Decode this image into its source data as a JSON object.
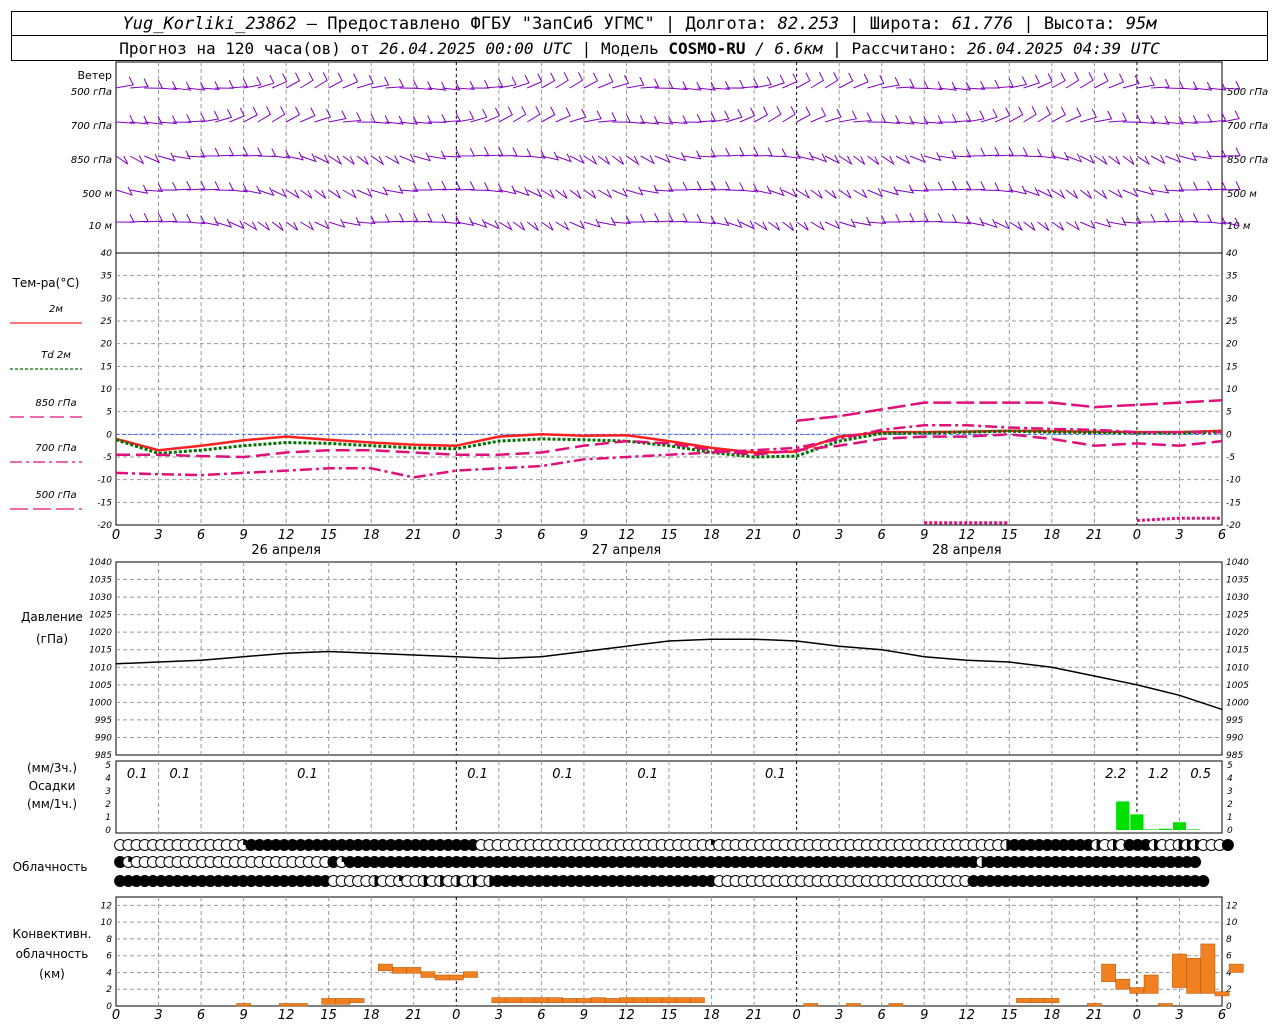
{
  "header": {
    "station": "Yug_Korliki_23862",
    "provider": "– Предоставлено ФГБУ \"ЗапСиб УГМС\"",
    "lon_label": "Долгота:",
    "lon": "82.253",
    "lat_label": "Широта:",
    "lat": "61.776",
    "alt_label": "Высота:",
    "alt": "95м",
    "forecast_prefix": "Прогноз на 120 часа(ов) от",
    "forecast_start": "26.04.2025 00:00 UTC",
    "model_label": "Модель",
    "model": "COSMO-RU",
    "model_res": "/ 6.6км",
    "calc_label": "Рассчитано:",
    "calc_time": "26.04.2025 04:39 UTC"
  },
  "colors": {
    "wind": "#8000c0",
    "t2m": "#ff2020",
    "td2m": "#007000",
    "level_lines": "#e0107a",
    "pressure": "#000000",
    "precip": "#00e000",
    "convective": "#f08020",
    "grid": "#999999"
  },
  "chart_data": [
    {
      "type": "wind_barbs",
      "title": "Ветер",
      "levels": [
        "500 гПа",
        "700 гПа",
        "850 гПа",
        "500 м",
        "10 м"
      ],
      "x_hours_step": 1,
      "x_range": [
        0,
        78
      ]
    },
    {
      "type": "line",
      "ylabel": "Тем-ра(°C)",
      "ylim": [
        -20,
        40
      ],
      "yticks": [
        40,
        35,
        30,
        25,
        20,
        15,
        10,
        5,
        0,
        -5,
        -10,
        -15,
        -20
      ],
      "x_hours": [
        0,
        3,
        6,
        9,
        12,
        15,
        18,
        21,
        24,
        27,
        30,
        33,
        36,
        39,
        42,
        45,
        48,
        51,
        54,
        57,
        60,
        63,
        66,
        69,
        72,
        75,
        78
      ],
      "x_ticklabels": [
        "0",
        "3",
        "6",
        "9",
        "12",
        "15",
        "18",
        "21",
        "0",
        "3",
        "6",
        "9",
        "12",
        "15",
        "18",
        "21",
        "0",
        "3",
        "6",
        "9",
        "12",
        "15",
        "18",
        "21",
        "0",
        "3",
        "6"
      ],
      "date_labels": [
        {
          "hour": 12,
          "label": "26 апреля"
        },
        {
          "hour": 36,
          "label": "27 апреля"
        },
        {
          "hour": 60,
          "label": "28 апреля"
        }
      ],
      "series": [
        {
          "name": "2м",
          "values": [
            -1,
            -3.5,
            -2.5,
            -1.3,
            -0.5,
            -1.2,
            -1.8,
            -2.3,
            -2.5,
            -0.5,
            0,
            -0.3,
            -0.2,
            -1.5,
            -3,
            -4,
            -3.8,
            -0.5,
            0.5,
            0.5,
            0.6,
            0.8,
            0.7,
            0.6,
            0.5,
            0.5,
            0.8
          ]
        },
        {
          "name": "Td 2м",
          "values": [
            -1.2,
            -4.2,
            -3.5,
            -2.5,
            -1.8,
            -2,
            -2.5,
            -3,
            -3.2,
            -1.5,
            -1,
            -1.2,
            -1.5,
            -2.5,
            -4,
            -5,
            -4.8,
            -1.5,
            0.2,
            0.3,
            0.5,
            0.7,
            0.5,
            0.4,
            0.3,
            0.3,
            0.5
          ]
        },
        {
          "name": "850 гПа",
          "values": [
            -4.5,
            -4.5,
            -4.8,
            -5,
            -4,
            -3.5,
            -3.5,
            -4,
            -4.5,
            -4.5,
            -4,
            -2.5,
            -1.5,
            -2,
            -3.5,
            -4.5,
            -3.5,
            -2.5,
            -1,
            -0.5,
            -0.5,
            0,
            -1,
            -2.5,
            -2,
            -2.5,
            -1.5
          ]
        },
        {
          "name": "700 гПа",
          "values": [
            -8.5,
            -8.8,
            -9,
            -8.5,
            -8,
            -7.5,
            -7.5,
            -9.5,
            -8,
            -7.5,
            -7,
            -5.5,
            -5,
            -4.5,
            -4,
            -3.5,
            -3,
            -1,
            1,
            2,
            2,
            1.5,
            1.2,
            1,
            0.5,
            0.5,
            0.5
          ]
        },
        {
          "name": "500 гПа",
          "values": [
            null,
            null,
            null,
            null,
            null,
            null,
            null,
            null,
            null,
            null,
            null,
            null,
            null,
            null,
            null,
            null,
            3,
            4,
            5.5,
            7,
            7,
            7,
            7,
            6,
            6.5,
            7,
            7.5
          ]
        },
        {
          "name": "500 гПа (2)",
          "values": [
            null,
            null,
            null,
            null,
            null,
            null,
            null,
            null,
            null,
            null,
            null,
            null,
            null,
            null,
            null,
            null,
            null,
            null,
            null,
            -19.5,
            -19.5,
            -19.5,
            null,
            null,
            -19,
            -18.5,
            -18.5
          ]
        }
      ],
      "legend": [
        "2м",
        "Td 2м",
        "850 гПа",
        "700 гПа",
        "500 гПа"
      ]
    },
    {
      "type": "line",
      "ylabel": "Давление",
      "yunit": "(гПа)",
      "ylim": [
        985,
        1040
      ],
      "yticks": [
        1040,
        1035,
        1030,
        1025,
        1020,
        1015,
        1010,
        1005,
        1000,
        995,
        990,
        985
      ],
      "x_hours": [
        0,
        3,
        6,
        9,
        12,
        15,
        18,
        21,
        24,
        27,
        30,
        33,
        36,
        39,
        42,
        45,
        48,
        51,
        54,
        57,
        60,
        63,
        66,
        69,
        72,
        75,
        78
      ],
      "series": [
        {
          "name": "Давление",
          "values": [
            1011,
            1011.5,
            1012,
            1013,
            1014,
            1014.5,
            1014,
            1013.5,
            1013,
            1012.5,
            1013,
            1014.5,
            1016,
            1017.5,
            1018,
            1018,
            1017.5,
            1016,
            1015,
            1013,
            1012,
            1011.5,
            1010,
            1007.5,
            1005,
            1002,
            998
          ]
        }
      ]
    },
    {
      "type": "bar",
      "ylabel": "Осадки",
      "yunit_top": "(мм/3ч.)",
      "yunit_bottom": "(мм/1ч.)",
      "ylim": [
        0,
        5
      ],
      "yticks": [
        5,
        4,
        3,
        2,
        1,
        0
      ],
      "totals_3h": [
        {
          "hour": 1.5,
          "label": "0.1"
        },
        {
          "hour": 4.5,
          "label": "0.1"
        },
        {
          "hour": 13.5,
          "label": "0.1"
        },
        {
          "hour": 25.5,
          "label": "0.1"
        },
        {
          "hour": 31.5,
          "label": "0.1"
        },
        {
          "hour": 37.5,
          "label": "0.1"
        },
        {
          "hour": 46.5,
          "label": "0.1"
        },
        {
          "hour": 70.5,
          "label": "2.2"
        },
        {
          "hour": 73.5,
          "label": "1.2"
        },
        {
          "hour": 76.5,
          "label": "0.5"
        }
      ],
      "hourly": [
        {
          "hour": 71,
          "value": 2.2
        },
        {
          "hour": 72,
          "value": 1.2
        },
        {
          "hour": 73,
          "value": 0.05
        },
        {
          "hour": 74,
          "value": 0.1
        },
        {
          "hour": 75,
          "value": 0.6
        },
        {
          "hour": 76,
          "value": 0.05
        }
      ]
    },
    {
      "type": "cloud_symbols",
      "label": "Облачность",
      "rows": [
        "ooooooooooooooovFFFFFFFFFFFFFFFFFFFFFFFFFFFFoooooooooooooooooooooooooooovoooooooooooooooooooooooooooooooooooHFFFFFFFFFFHoHoFFFHooHHHoooF",
        "FvooooooooooooooooooooooooFvFFFFFFFFFFFFFFFFFFFFFFFFFFFFFFFFFFFFFFFFFFFFFFFFFFFFFFFFFFFFFFFFFFFFFFFFFFFFFHFFFFFFFFFFFFFFFFFFFFFFFFFF",
        "FFFFFFFFFFFFFFFFFFFFFFFFFFoooooHoovooHoHoHoHoHFFFFFFFFFFFFFFFFFFFFFFFFFFFoooooooooooooooooooooooooooooooFFFFFFFFFFFFFFFFFFFFFFFFFFFFF"
      ]
    },
    {
      "type": "bar",
      "ylabel": "Конвективн.",
      "ylabel2": "облачность",
      "yunit": "(км)",
      "ylim": [
        0,
        13
      ],
      "yticks": [
        12,
        10,
        8,
        6,
        4,
        2,
        0
      ],
      "x_ticklabels": [
        "0",
        "3",
        "6",
        "9",
        "12",
        "15",
        "18",
        "21",
        "0",
        "3",
        "6",
        "9",
        "12",
        "15",
        "18",
        "21",
        "0",
        "3",
        "6",
        "9",
        "12",
        "15",
        "18",
        "21",
        "0",
        "3",
        "6"
      ],
      "bars": [
        {
          "hour": 9,
          "bottom": 0,
          "top": 0.3
        },
        {
          "hour": 12,
          "bottom": 0,
          "top": 0.3
        },
        {
          "hour": 13,
          "bottom": 0,
          "top": 0.3
        },
        {
          "hour": 15,
          "bottom": 0.2,
          "top": 0.9
        },
        {
          "hour": 16,
          "bottom": 0.2,
          "top": 0.9
        },
        {
          "hour": 17,
          "bottom": 0.4,
          "top": 0.9
        },
        {
          "hour": 19,
          "bottom": 4.2,
          "top": 5
        },
        {
          "hour": 20,
          "bottom": 3.9,
          "top": 4.6
        },
        {
          "hour": 21,
          "bottom": 3.9,
          "top": 4.6
        },
        {
          "hour": 22,
          "bottom": 3.4,
          "top": 4.1
        },
        {
          "hour": 23,
          "bottom": 3.1,
          "top": 3.7
        },
        {
          "hour": 24,
          "bottom": 3.1,
          "top": 3.7
        },
        {
          "hour": 25,
          "bottom": 3.4,
          "top": 4.1
        },
        {
          "hour": 27,
          "bottom": 0.4,
          "top": 1
        },
        {
          "hour": 28,
          "bottom": 0.4,
          "top": 1
        },
        {
          "hour": 29,
          "bottom": 0.4,
          "top": 1
        },
        {
          "hour": 30,
          "bottom": 0.4,
          "top": 1
        },
        {
          "hour": 31,
          "bottom": 0.4,
          "top": 1
        },
        {
          "hour": 32,
          "bottom": 0.4,
          "top": 0.9
        },
        {
          "hour": 33,
          "bottom": 0.4,
          "top": 0.9
        },
        {
          "hour": 34,
          "bottom": 0.4,
          "top": 1
        },
        {
          "hour": 35,
          "bottom": 0.4,
          "top": 0.9
        },
        {
          "hour": 36,
          "bottom": 0.4,
          "top": 1
        },
        {
          "hour": 37,
          "bottom": 0.4,
          "top": 1
        },
        {
          "hour": 38,
          "bottom": 0.4,
          "top": 1
        },
        {
          "hour": 39,
          "bottom": 0.4,
          "top": 1
        },
        {
          "hour": 40,
          "bottom": 0.4,
          "top": 1
        },
        {
          "hour": 41,
          "bottom": 0.4,
          "top": 1
        },
        {
          "hour": 49,
          "bottom": 0,
          "top": 0.3
        },
        {
          "hour": 52,
          "bottom": 0,
          "top": 0.3
        },
        {
          "hour": 55,
          "bottom": 0,
          "top": 0.3
        },
        {
          "hour": 64,
          "bottom": 0.4,
          "top": 0.9
        },
        {
          "hour": 65,
          "bottom": 0.4,
          "top": 0.9
        },
        {
          "hour": 66,
          "bottom": 0.4,
          "top": 0.9
        },
        {
          "hour": 69,
          "bottom": 0,
          "top": 0.3
        },
        {
          "hour": 70,
          "bottom": 2.9,
          "top": 5
        },
        {
          "hour": 71,
          "bottom": 2,
          "top": 3.2
        },
        {
          "hour": 72,
          "bottom": 1.5,
          "top": 2.2
        },
        {
          "hour": 73,
          "bottom": 1.5,
          "top": 3.7
        },
        {
          "hour": 74,
          "bottom": 0,
          "top": 0.3
        },
        {
          "hour": 75,
          "bottom": 2.2,
          "top": 6.2
        },
        {
          "hour": 76,
          "bottom": 1.5,
          "top": 5.7
        },
        {
          "hour": 77,
          "bottom": 1.5,
          "top": 7.4
        },
        {
          "hour": 78,
          "bottom": 1.2,
          "top": 1.7
        },
        {
          "hour": 79,
          "bottom": 4,
          "top": 5
        }
      ]
    }
  ]
}
